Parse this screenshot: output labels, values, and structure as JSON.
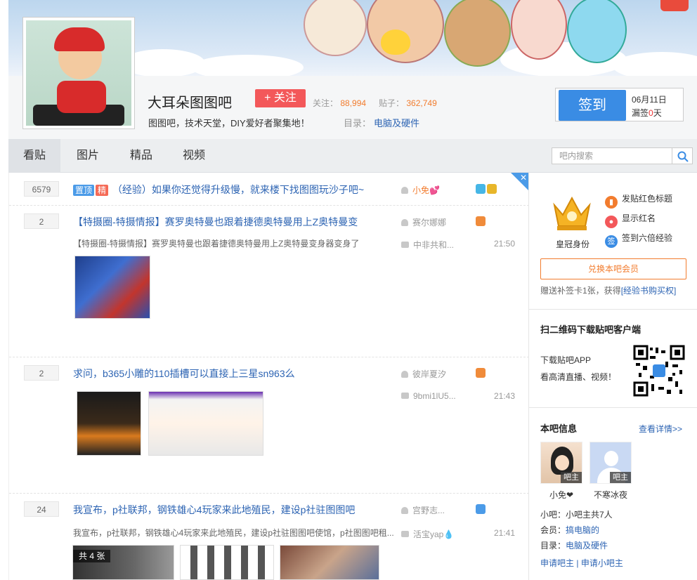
{
  "forum": {
    "name": "大耳朵图图吧",
    "follow_label": "+ 关注",
    "follow_count_label": "关注：",
    "follow_count": "88,994",
    "post_count_label": "贴子：",
    "post_count": "362,749",
    "slogan": "图图吧，技术天堂，DIY爱好者聚集地！",
    "category_label": "目录：",
    "category": "电脑及硬件"
  },
  "signin": {
    "button": "签到",
    "date": "06月11日",
    "missed_prefix": "漏签",
    "missed_days": "0",
    "missed_suffix": "天"
  },
  "nav": {
    "tabs": [
      "看贴",
      "图片",
      "精品",
      "视频"
    ],
    "search_placeholder": "吧内搜索"
  },
  "threads": [
    {
      "count": "6579",
      "tags": [
        "置顶",
        "精"
      ],
      "title": "（经验）如果你还觉得升级慢，就来楼下找图图玩沙子吧~",
      "author": "小免💕"
    },
    {
      "count": "2",
      "title": "【特摄圈-特摄情报】赛罗奥特曼也跟着捷德奥特曼用上Z奥特曼变",
      "desc": "【特摄圈-特摄情报】赛罗奥特曼也跟着捷德奥特曼用上Z奥特曼变身器变身了",
      "author": "赛尔娜娜",
      "replier": "中非共和...",
      "time": "21:50"
    },
    {
      "count": "2",
      "title": "求问，b365小雕的110插槽可以直接上三星sn963么",
      "author": "彼岸夏汐",
      "replier": "9bmi1lU5...",
      "time": "21:43"
    },
    {
      "count": "24",
      "title": "我宣布，p社联邦，钢铁雄心4玩家来此地殖民，建设p社驻图图吧",
      "desc": "我宣布，p社联邦，钢铁雄心4玩家来此地殖民，建设p社驻图图吧使馆，p社图图吧租...",
      "author": "宫野志...",
      "replier": "活宝yap💧",
      "time": "21:41",
      "image_count": "共 4 张"
    }
  ],
  "sidebar": {
    "crown_label": "皇冠身份",
    "perks": [
      "发贴红色标题",
      "显示红名",
      "签到六倍经验"
    ],
    "member_button": "兑换本吧会员",
    "gift_text": "赠送补签卡1张，获得",
    "gift_link": "[经验书购买权]",
    "qr_title": "扫二维码下载贴吧客户端",
    "qr_line1": "下载贴吧APP",
    "qr_line2": "看高清直播、视频！",
    "info_title": "本吧信息",
    "info_more": "查看详情>>",
    "managers": [
      {
        "name": "小免❤",
        "role": "吧主"
      },
      {
        "name": "不寒冰夜",
        "role": "吧主"
      }
    ],
    "small_mgr": "小吧：小吧主共7人",
    "members_label": "会员：",
    "members_value": "搞电脑的",
    "dir_label": "目录：",
    "dir_value": "电脑及硬件",
    "apply1": "申请吧主",
    "apply_sep": "|",
    "apply2": "申请小吧主"
  }
}
